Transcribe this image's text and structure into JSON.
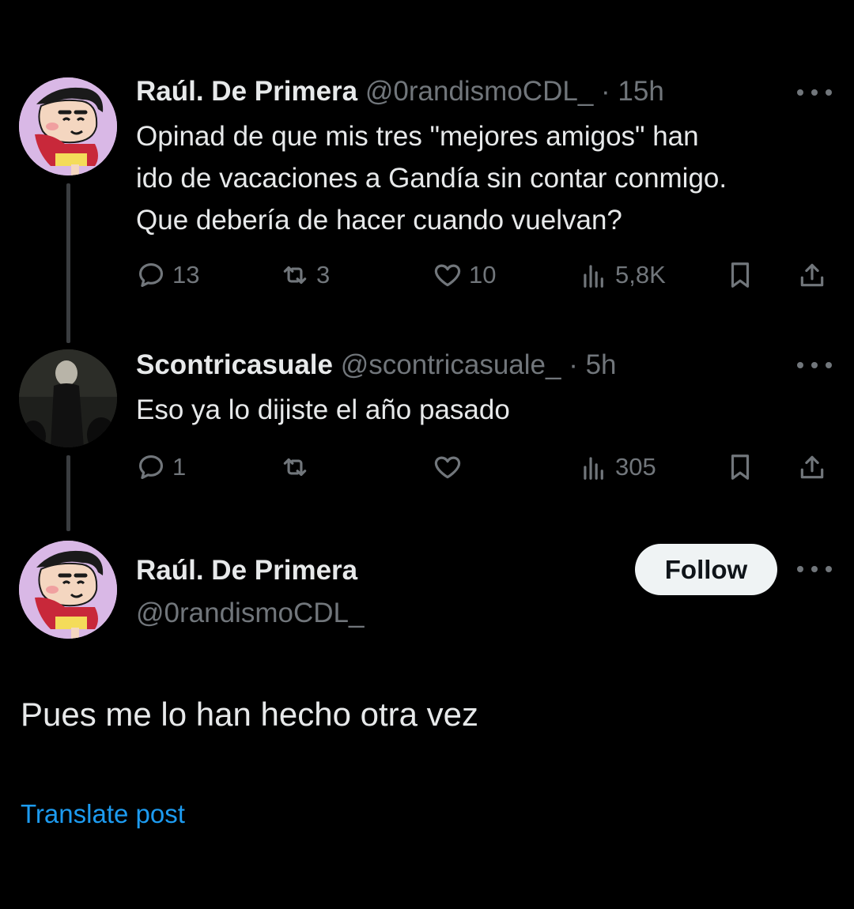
{
  "thread": [
    {
      "name": "Raúl. De Primera",
      "handle": "@0randismoCDL_",
      "time": "· 15h",
      "text": "Opinad de que mis tres \"mejores amigos\" han\nido de vacaciones a Gandía sin contar conmigo.\nQue debería de hacer cuando vuelvan?",
      "stats": {
        "replies": "13",
        "reposts": "3",
        "likes": "10",
        "views": "5,8K"
      }
    },
    {
      "name": "Scontricasuale",
      "handle": "@scontricasuale_",
      "time": "· 5h",
      "text": "Eso ya lo dijiste el año pasado",
      "stats": {
        "replies": "1",
        "reposts": "",
        "likes": "",
        "views": "305"
      }
    }
  ],
  "main_post": {
    "name": "Raúl. De Primera",
    "handle": "@0randismoCDL_",
    "follow_label": "Follow",
    "text": "Pues me lo han hecho otra vez",
    "translate_label": "Translate post"
  },
  "colors": {
    "background": "#000000",
    "text": "#e7e9ea",
    "secondary": "#71767b",
    "link": "#1d9bf0",
    "follow_button_bg": "#eff3f4"
  },
  "icons": [
    "reply-icon",
    "repost-icon",
    "like-icon",
    "views-icon",
    "bookmark-icon",
    "share-icon",
    "more-icon"
  ]
}
